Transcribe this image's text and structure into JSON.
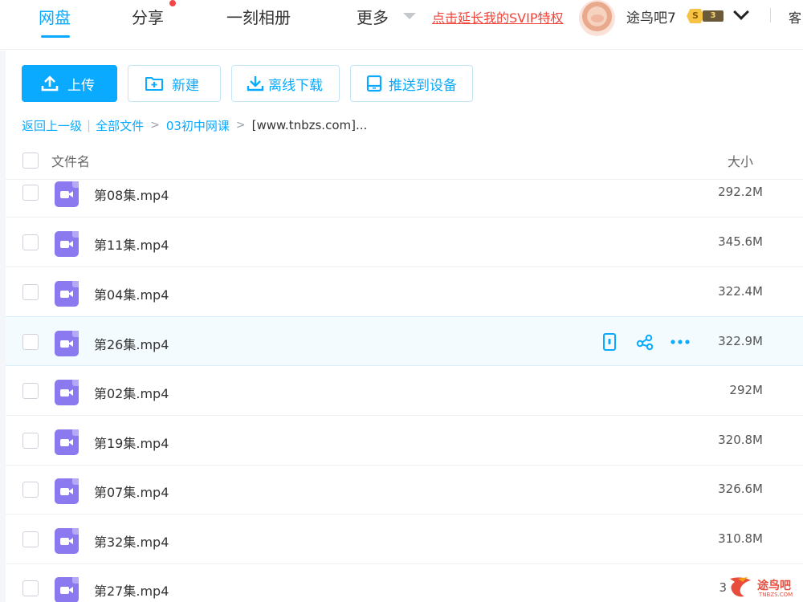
{
  "nav": {
    "tabs": [
      {
        "label": "网盘",
        "active": true
      },
      {
        "label": "分享",
        "has_dot": true
      },
      {
        "label": "一刻相册"
      },
      {
        "label": "更多"
      }
    ],
    "svip_link": "点击延长我的SVIP特权",
    "username": "途鸟吧7",
    "badge_s": "S",
    "badge_level": "3",
    "client_label": "客"
  },
  "toolbar": {
    "upload": "上传",
    "new_folder": "新建",
    "offline_download": "离线下载",
    "push_to_device": "推送到设备"
  },
  "breadcrumb": {
    "back": "返回上一级",
    "all_files": "全部文件",
    "folder": "03初中网课",
    "current": "[www.tnbzs.com]..."
  },
  "list_header": {
    "name": "文件名",
    "size": "大小"
  },
  "files": [
    {
      "name": "第08集.mp4",
      "size": "292.2M"
    },
    {
      "name": "第11集.mp4",
      "size": "345.6M"
    },
    {
      "name": "第04集.mp4",
      "size": "322.4M"
    },
    {
      "name": "第26集.mp4",
      "size": "322.9M",
      "hovered": true
    },
    {
      "name": "第02集.mp4",
      "size": "292M"
    },
    {
      "name": "第19集.mp4",
      "size": "320.8M"
    },
    {
      "name": "第07集.mp4",
      "size": "326.6M"
    },
    {
      "name": "第32集.mp4",
      "size": "310.8M"
    },
    {
      "name": "第27集.mp4",
      "size": "3"
    }
  ],
  "watermark": {
    "text": "途鸟吧",
    "sub": "TNBZS.COM"
  },
  "colors": {
    "accent": "#09aaff",
    "svip_red": "#f0443a",
    "video_icon": "#8b79f0"
  }
}
